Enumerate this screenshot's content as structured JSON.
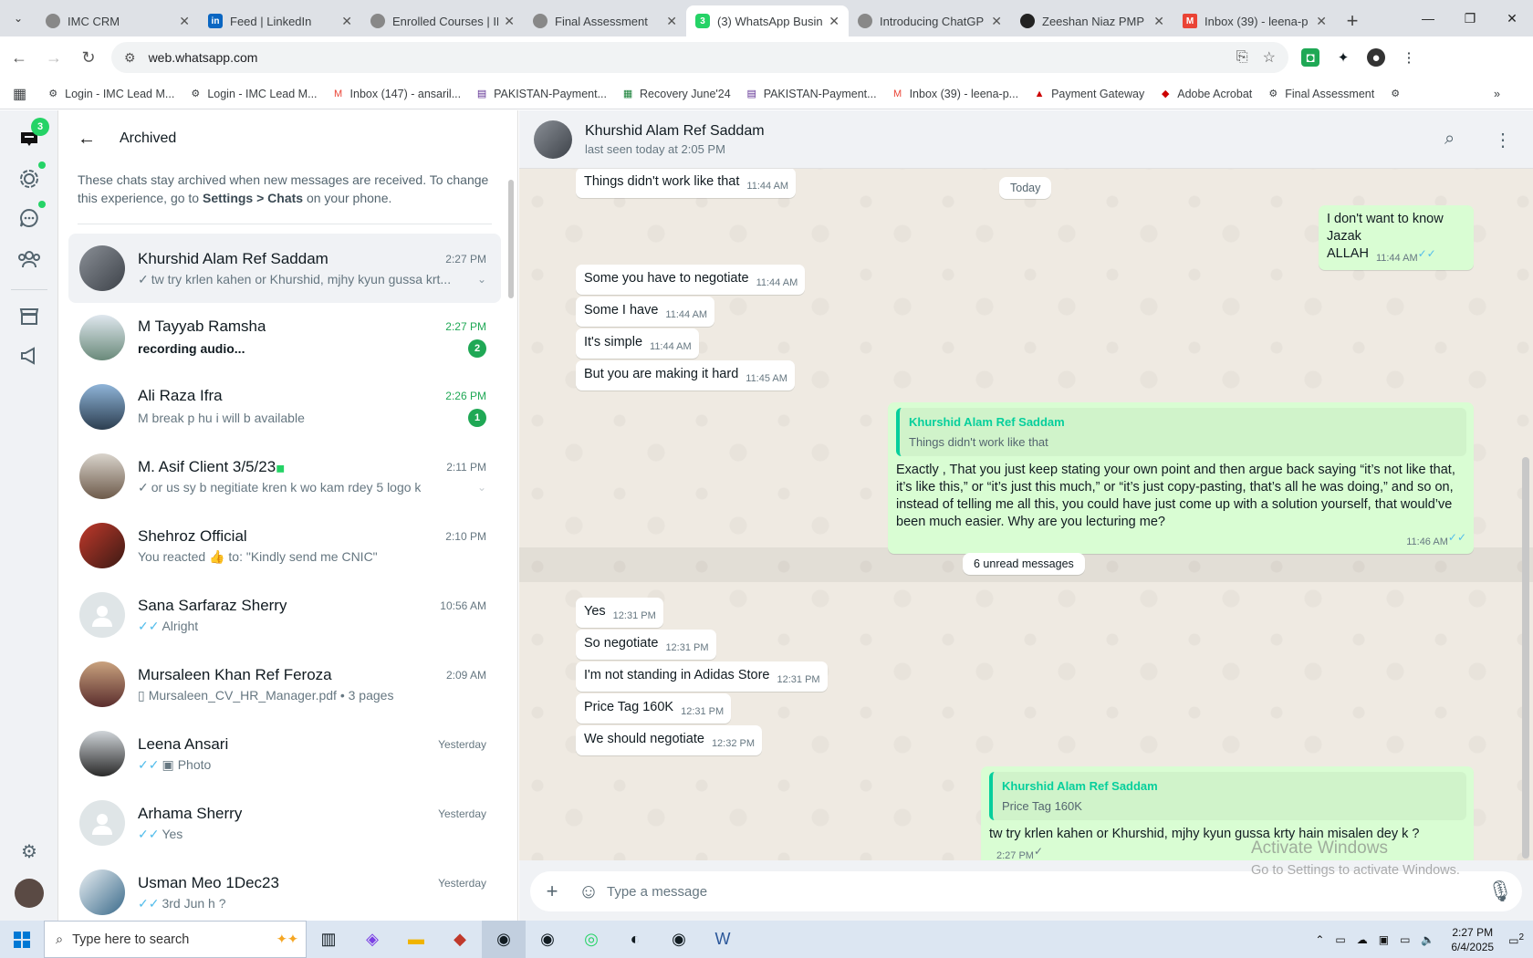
{
  "browser": {
    "tabs": [
      {
        "title": "IMC CRM",
        "active": false
      },
      {
        "title": "Feed | LinkedIn",
        "active": false
      },
      {
        "title": "Enrolled Courses | IM",
        "active": false
      },
      {
        "title": "Final Assessment",
        "active": false
      },
      {
        "title": "(3) WhatsApp Busin",
        "active": true,
        "badge": "3"
      },
      {
        "title": "Introducing ChatGP",
        "active": false
      },
      {
        "title": "Zeeshan Niaz PMP |",
        "active": false
      },
      {
        "title": "Inbox (39) - leena-p",
        "active": false
      }
    ],
    "url": "web.whatsapp.com",
    "bookmarks": [
      "Login - IMC Lead M...",
      "Login - IMC Lead M...",
      "Inbox (147) - ansaril...",
      "PAKISTAN-Payment...",
      "Recovery June'24",
      "PAKISTAN-Payment...",
      "Inbox (39) - leena-p...",
      "Payment Gateway",
      "Adobe Acrobat",
      "Final Assessment"
    ]
  },
  "sidebar": {
    "unread_badge": "3",
    "header_title": "Archived",
    "note_prefix": "These chats stay archived when new messages are received. To change this experience, go to ",
    "note_settings": "Settings > Chats",
    "note_suffix": " on your phone.",
    "chats": [
      {
        "name": "Khurshid Alam Ref Saddam",
        "time": "2:27 PM",
        "preview": "tw try krlen kahen or Khurshid, mjhy kyun gussa krt...",
        "tick": "✓"
      },
      {
        "name": "M Tayyab Ramsha",
        "time": "2:27 PM",
        "preview": "recording audio...",
        "unread": "2"
      },
      {
        "name": "Ali Raza Ifra",
        "time": "2:26 PM",
        "preview": "M break p hu i will b available",
        "unread": "1"
      },
      {
        "name": "M. Asif Client 3/5/23",
        "time": "2:11 PM",
        "preview": "or us sy b negitiate kren k wo kam rdey 5 logo k",
        "tick": "✓"
      },
      {
        "name": "Shehroz Official",
        "time": "2:10 PM",
        "preview": "You reacted 👍 to: \"Kindly send me CNIC\""
      },
      {
        "name": "Sana Sarfaraz Sherry",
        "time": "10:56 AM",
        "preview": "Alright",
        "tick": "✓✓"
      },
      {
        "name": "Mursaleen Khan Ref Feroza",
        "time": "2:09 AM",
        "preview": "Mursaleen_CV_HR_Manager.pdf • 3 pages"
      },
      {
        "name": "Leena Ansari",
        "time": "Yesterday",
        "preview": "Photo",
        "tick": "✓✓"
      },
      {
        "name": "Arhama Sherry",
        "time": "Yesterday",
        "preview": "Yes",
        "tick": "✓✓"
      },
      {
        "name": "Usman Meo 1Dec23",
        "time": "Yesterday",
        "preview": "3rd Jun h ?",
        "tick": "✓✓"
      }
    ]
  },
  "chat": {
    "contact_name": "Khurshid Alam Ref Saddam",
    "status": "last seen today at 2:05 PM",
    "day_label": "Today",
    "unread_label": "6 unread messages",
    "messages": [
      {
        "dir": "in",
        "text": "Things didn't work like that",
        "time": "11:44 AM"
      },
      {
        "dir": "out",
        "text": "I don't want to know",
        "text2": "Jazak ALLAH",
        "time": "11:44 AM"
      },
      {
        "dir": "in",
        "text": "Some you have to negotiate",
        "time": "11:44 AM"
      },
      {
        "dir": "in",
        "text": "Some I have",
        "time": "11:44 AM"
      },
      {
        "dir": "in",
        "text": "It's simple",
        "time": "11:44 AM"
      },
      {
        "dir": "in",
        "text": "But you are making it hard",
        "time": "11:45 AM"
      },
      {
        "dir": "out",
        "quote_name": "Khurshid Alam Ref Saddam",
        "quote_text": "Things didn't work like that",
        "text": "Exactly , That you just keep stating your own point and then argue back saying “it’s not like that, it’s like this,” or “it’s just this much,” or “it’s just copy-pasting, that’s all he was doing,” and so on, instead of telling me all this, you could have just come up with a solution yourself, that would’ve been much easier. Why are you lecturing me?",
        "time": "11:46 AM"
      },
      {
        "dir": "in",
        "text": "Yes",
        "time": "12:31 PM"
      },
      {
        "dir": "in",
        "text": "So negotiate",
        "time": "12:31 PM"
      },
      {
        "dir": "in",
        "text": "I'm not standing in Adidas Store",
        "time": "12:31 PM"
      },
      {
        "dir": "in",
        "text": "Price Tag 160K",
        "time": "12:31 PM"
      },
      {
        "dir": "in",
        "text": "We should negotiate",
        "time": "12:32 PM"
      },
      {
        "dir": "out",
        "quote_name": "Khurshid Alam Ref Saddam",
        "quote_text": "Price Tag 160K",
        "text": "tw try krlen kahen or Khurshid, mjhy kyun gussa krty hain misalen dey k ?",
        "time": "2:27 PM"
      }
    ],
    "input_placeholder": "Type a message"
  },
  "watermark": {
    "line1": "Activate Windows",
    "line2": "Go to Settings to activate Windows."
  },
  "taskbar": {
    "search_placeholder": "Type here to search",
    "time": "2:27 PM",
    "date": "6/4/2025",
    "notif_count": "2"
  }
}
